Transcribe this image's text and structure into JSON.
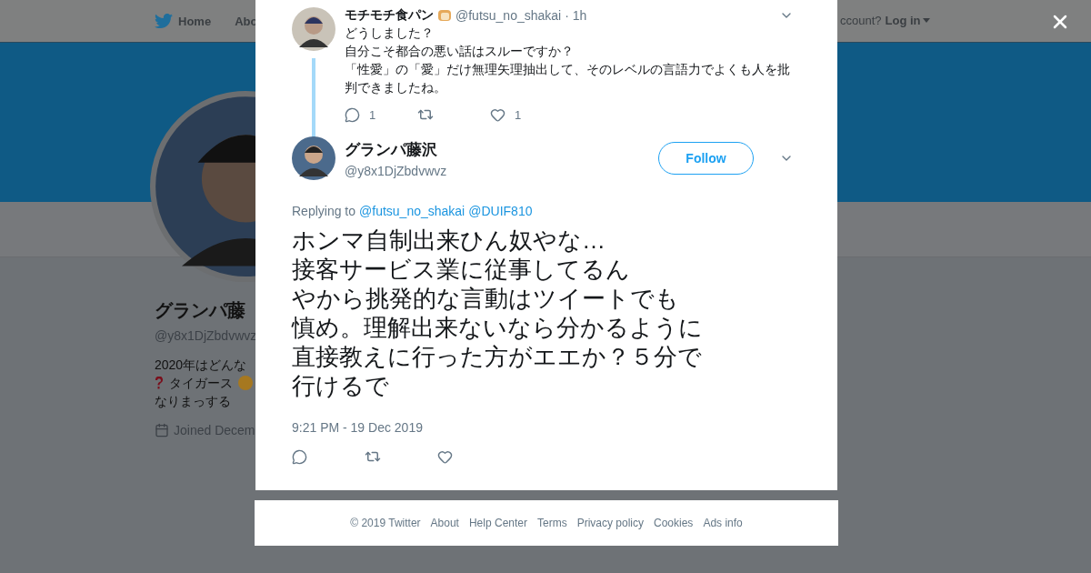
{
  "background_page": {
    "nav": {
      "items": [
        {
          "label": "Home"
        },
        {
          "label": "Abo"
        }
      ],
      "account_prompt": "ccount?",
      "login": "Log in"
    },
    "profile": {
      "name": "グランパ藤",
      "handle": "@y8x1DjZbdvwvz",
      "bio": [
        "2020年はどんな",
        "タイガース",
        "なりまっする"
      ],
      "joined": "Joined Decem"
    }
  },
  "modal": {
    "parent_tweet": {
      "name": "モチモチ食パン",
      "handle": "@futsu_no_shakai",
      "time": "· 1h",
      "text": [
        "どうしました？",
        "自分こそ都合の悪い話はスルーですか？",
        "「性愛」の「愛」だけ無理矢理抽出して、そのレベルの言語力でよくも人を批",
        "判できましたね。"
      ],
      "replies": "1",
      "likes": "1"
    },
    "tweet": {
      "name": "グランパ藤沢",
      "handle": "@y8x1DjZbdvwvz",
      "follow": "Follow",
      "replying_label": "Replying to",
      "replying_to": [
        "@futsu_no_shakai",
        "@DUIF810"
      ],
      "text": [
        "ホンマ自制出来ひん奴やな…",
        "接客サービス業に従事してるん",
        "やから挑発的な言動はツイートでも",
        "慎め。理解出来ないなら分かるように",
        "直接教えに行った方がエエか？５分で",
        "行けるで"
      ],
      "timestamp": "9:21 PM - 19 Dec 2019"
    }
  },
  "footer": {
    "links": [
      "© 2019 Twitter",
      "About",
      "Help Center",
      "Terms",
      "Privacy policy",
      "Cookies",
      "Ads info"
    ]
  }
}
